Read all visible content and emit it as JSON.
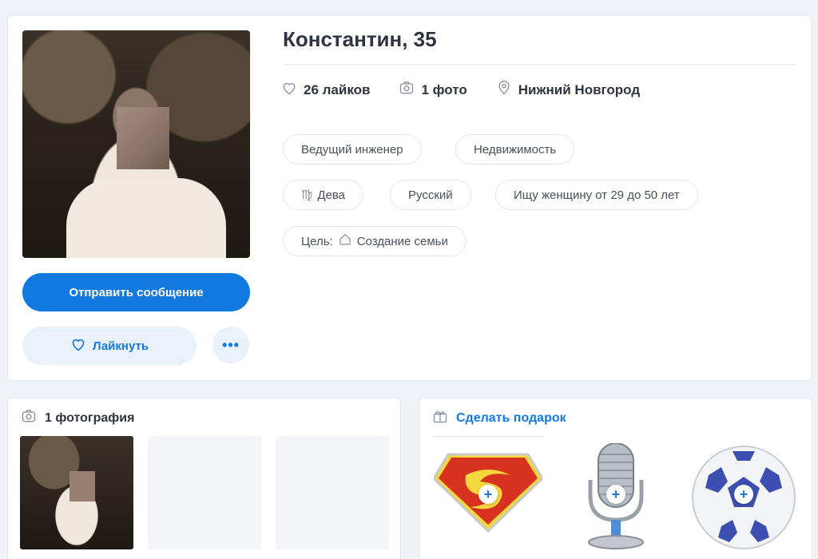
{
  "profile": {
    "name_age": "Константин, 35",
    "send_message_label": "Отправить сообщение",
    "like_label": "Лайкнуть",
    "more_label": "•••",
    "stats": {
      "likes": "26 лайков",
      "photos": "1 фото",
      "city": "Нижний Новгород"
    },
    "tags": {
      "job": "Ведущий инженер",
      "industry": "Недвижимость",
      "zodiac": "Дева",
      "nationality": "Русский",
      "seeking": "Ищу женщину от 29 до 50 лет",
      "goal_prefix": "Цель:",
      "goal_value": "Создание семьи"
    }
  },
  "photos_section": {
    "title": "1 фотография"
  },
  "gifts_section": {
    "title": "Сделать подарок",
    "plus": "+",
    "items": [
      "superman-emblem-gift",
      "microphone-gift",
      "soccer-ball-gift"
    ]
  },
  "colors": {
    "accent": "#1279e1",
    "accent_light": "#e9f1fb",
    "background": "#eef1f6"
  }
}
